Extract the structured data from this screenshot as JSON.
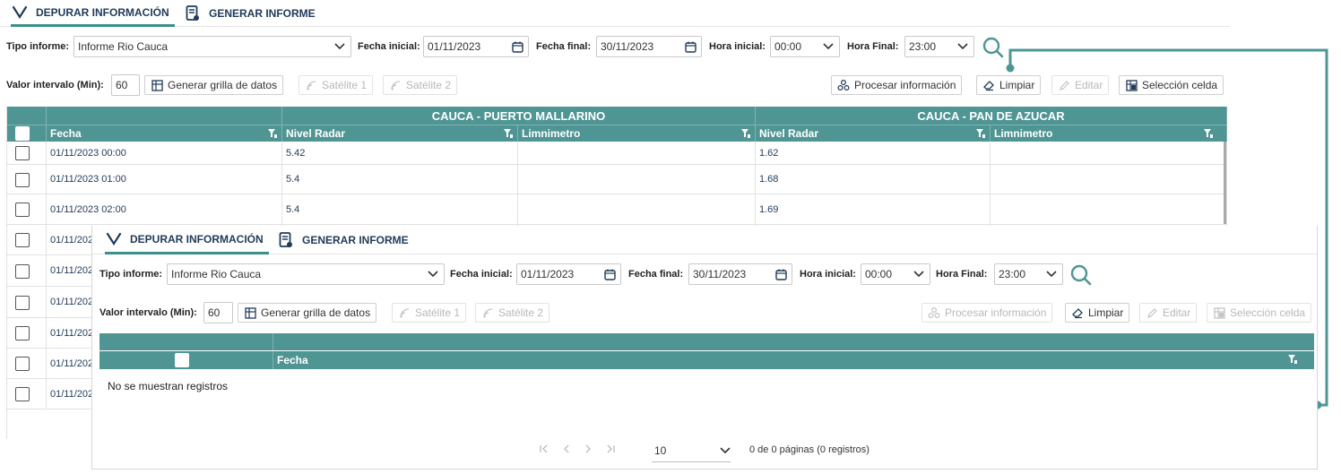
{
  "top": {
    "tabs": [
      {
        "label": "DEPURAR INFORMACIÓN",
        "icon": "filter-funnel-icon"
      },
      {
        "label": "GENERAR INFORME",
        "icon": "report-document-icon"
      }
    ],
    "labels": {
      "tipo_informe": "Tipo informe:",
      "fecha_inicial": "Fecha inicial:",
      "fecha_final": "Fecha final:",
      "hora_inicial": "Hora inicial:",
      "hora_final": "Hora Final:",
      "valor_intervalo": "Valor intervalo (Min):"
    },
    "values": {
      "tipo_informe": "Informe Rio Cauca",
      "fecha_inicial": "01/11/2023",
      "fecha_final": "30/11/2023",
      "hora_inicial": "00:00",
      "hora_final": "23:00",
      "valor_intervalo": "60"
    },
    "buttons": {
      "generar": "Generar grilla de datos",
      "satelite1": "Satélite 1",
      "satelite2": "Satélite 2",
      "procesar": "Procesar información",
      "limpiar": "Limpiar",
      "editar": "Editar",
      "seleccion": "Selección celda"
    },
    "grid": {
      "groups": [
        "CAUCA - PUERTO MALLARINO",
        "CAUCA - PAN DE AZUCAR"
      ],
      "columns": [
        "Fecha",
        "Nivel Radar",
        "Limnimetro",
        "Nivel Radar",
        "Limnimetro"
      ],
      "rows": [
        [
          "01/11/2023 00:00",
          "5.42",
          "",
          "1.62",
          ""
        ],
        [
          "01/11/2023 01:00",
          "5.4",
          "",
          "1.68",
          ""
        ],
        [
          "01/11/2023 02:00",
          "5.4",
          "",
          "1.69",
          ""
        ],
        [
          "01/11/202",
          "",
          "",
          "",
          ""
        ],
        [
          "01/11/202",
          "",
          "",
          "",
          ""
        ],
        [
          "01/11/202",
          "",
          "",
          "",
          ""
        ],
        [
          "01/11/202",
          "",
          "",
          "",
          ""
        ],
        [
          "01/11/202",
          "",
          "",
          "",
          ""
        ],
        [
          "01/11/202",
          "",
          "",
          "",
          ""
        ]
      ]
    }
  },
  "bottom": {
    "tabs": [
      {
        "label": "DEPURAR INFORMACIÓN",
        "icon": "filter-funnel-icon"
      },
      {
        "label": "GENERAR INFORME",
        "icon": "report-document-icon"
      }
    ],
    "labels": {
      "tipo_informe": "Tipo informe:",
      "fecha_inicial": "Fecha inicial:",
      "fecha_final": "Fecha final:",
      "hora_inicial": "Hora inicial:",
      "hora_final": "Hora Final:",
      "valor_intervalo": "Valor intervalo (Min):"
    },
    "values": {
      "tipo_informe": "Informe Rio Cauca",
      "fecha_inicial": "01/11/2023",
      "fecha_final": "30/11/2023",
      "hora_inicial": "00:00",
      "hora_final": "23:00",
      "valor_intervalo": "60"
    },
    "buttons": {
      "generar": "Generar grilla de datos",
      "satelite1": "Satélite 1",
      "satelite2": "Satélite 2",
      "procesar": "Procesar información",
      "limpiar": "Limpiar",
      "editar": "Editar",
      "seleccion": "Selección celda"
    },
    "grid": {
      "columns": [
        "Fecha"
      ],
      "empty": "No se muestran registros"
    },
    "pager": {
      "page_size": "10",
      "summary": "0 de 0 páginas (0 registros)"
    }
  },
  "colors": {
    "accent": "#4f9594",
    "text_dark": "#1f3a5a",
    "disabled": "#b8b8b8"
  }
}
